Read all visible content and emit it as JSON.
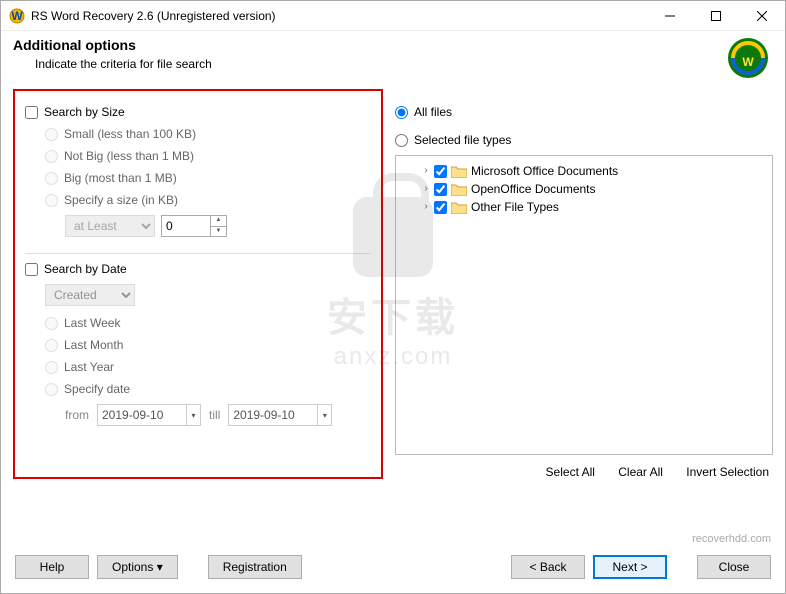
{
  "window": {
    "title": "RS Word Recovery 2.6 (Unregistered version)"
  },
  "header": {
    "title": "Additional options",
    "subtitle": "Indicate the criteria for file search"
  },
  "size": {
    "check_label": "Search by Size",
    "small": "Small (less than 100 KB)",
    "notbig": "Not Big (less than 1 MB)",
    "big": "Big (most than 1 MB)",
    "specify": "Specify a size (in KB)",
    "mode": "at Least",
    "value": "0"
  },
  "date": {
    "check_label": "Search by Date",
    "created": "Created",
    "last_week": "Last Week",
    "last_month": "Last Month",
    "last_year": "Last Year",
    "specify": "Specify date",
    "from_label": "from",
    "from_value": "2019-09-10",
    "till_label": "till",
    "till_value": "2019-09-10"
  },
  "files": {
    "all": "All files",
    "selected": "Selected file types",
    "items": {
      "0": "Microsoft Office Documents",
      "1": "OpenOffice Documents",
      "2": "Other File Types"
    },
    "select_all": "Select All",
    "clear_all": "Clear All",
    "invert": "Invert Selection"
  },
  "footer": {
    "url": "recoverhdd.com",
    "help": "Help",
    "options": "Options ▾",
    "registration": "Registration",
    "back": "< Back",
    "next": "Next >",
    "close": "Close"
  },
  "watermark": {
    "line1": "安下载",
    "line2": "anxz.com"
  }
}
